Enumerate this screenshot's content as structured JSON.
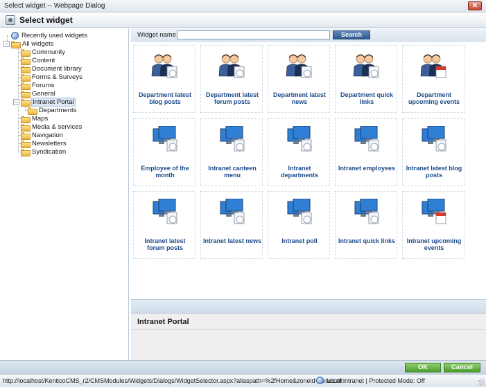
{
  "window": {
    "title": "Select widget -- Webpage Dialog",
    "close_glyph": "✕"
  },
  "dialog": {
    "title": "Select widget"
  },
  "tree": {
    "recent": "Recently used widgets",
    "root": "All widgets",
    "items": [
      "Community",
      "Content",
      "Document library",
      "Forms & Surveys",
      "Forums",
      "General",
      "Intranet Portal",
      "Maps",
      "Media & services",
      "Navigation",
      "Newsletters",
      "Syndication"
    ],
    "selected": "Intranet Portal",
    "child": "Departments",
    "expander_open": "−"
  },
  "search": {
    "label": "Widget name:",
    "value": "",
    "button": "Search"
  },
  "widgets": [
    {
      "name": "Department latest blog posts",
      "icon": "department-blog-icon"
    },
    {
      "name": "Department latest forum posts",
      "icon": "department-forum-icon"
    },
    {
      "name": "Department latest news",
      "icon": "department-news-icon"
    },
    {
      "name": "Department quick links",
      "icon": "department-links-icon"
    },
    {
      "name": "Department upcoming events",
      "icon": "department-events-icon"
    },
    {
      "name": "Employee of the month",
      "icon": "employee-month-icon"
    },
    {
      "name": "Intranet canteen menu",
      "icon": "canteen-menu-icon"
    },
    {
      "name": "Intranet departments",
      "icon": "intranet-departments-icon"
    },
    {
      "name": "Intranet employees",
      "icon": "intranet-employees-icon"
    },
    {
      "name": "Intranet latest blog posts",
      "icon": "intranet-blog-icon"
    },
    {
      "name": "Intranet latest forum posts",
      "icon": "intranet-forum-icon"
    },
    {
      "name": "Intranet latest news",
      "icon": "intranet-news-icon"
    },
    {
      "name": "Intranet poll",
      "icon": "intranet-poll-icon"
    },
    {
      "name": "Intranet quick links",
      "icon": "intranet-links-icon"
    },
    {
      "name": "Intranet upcoming events",
      "icon": "intranet-events-icon"
    }
  ],
  "info": {
    "title": "Intranet Portal"
  },
  "buttons": {
    "ok": "OK",
    "cancel": "Cancel"
  },
  "status": {
    "url": "http://localhost/KenticoCMS_r2/CMSModules/Widgets/Dialogs/WidgetSelector.aspx?aliaspath=%2fHome&zoneid=zoneLeft",
    "zone": "Local intranet | Protected Mode: Off"
  },
  "colors": {
    "link": "#1c4a8a",
    "ok_button": "#4c9d2c",
    "search_button": "#2f5a91"
  }
}
